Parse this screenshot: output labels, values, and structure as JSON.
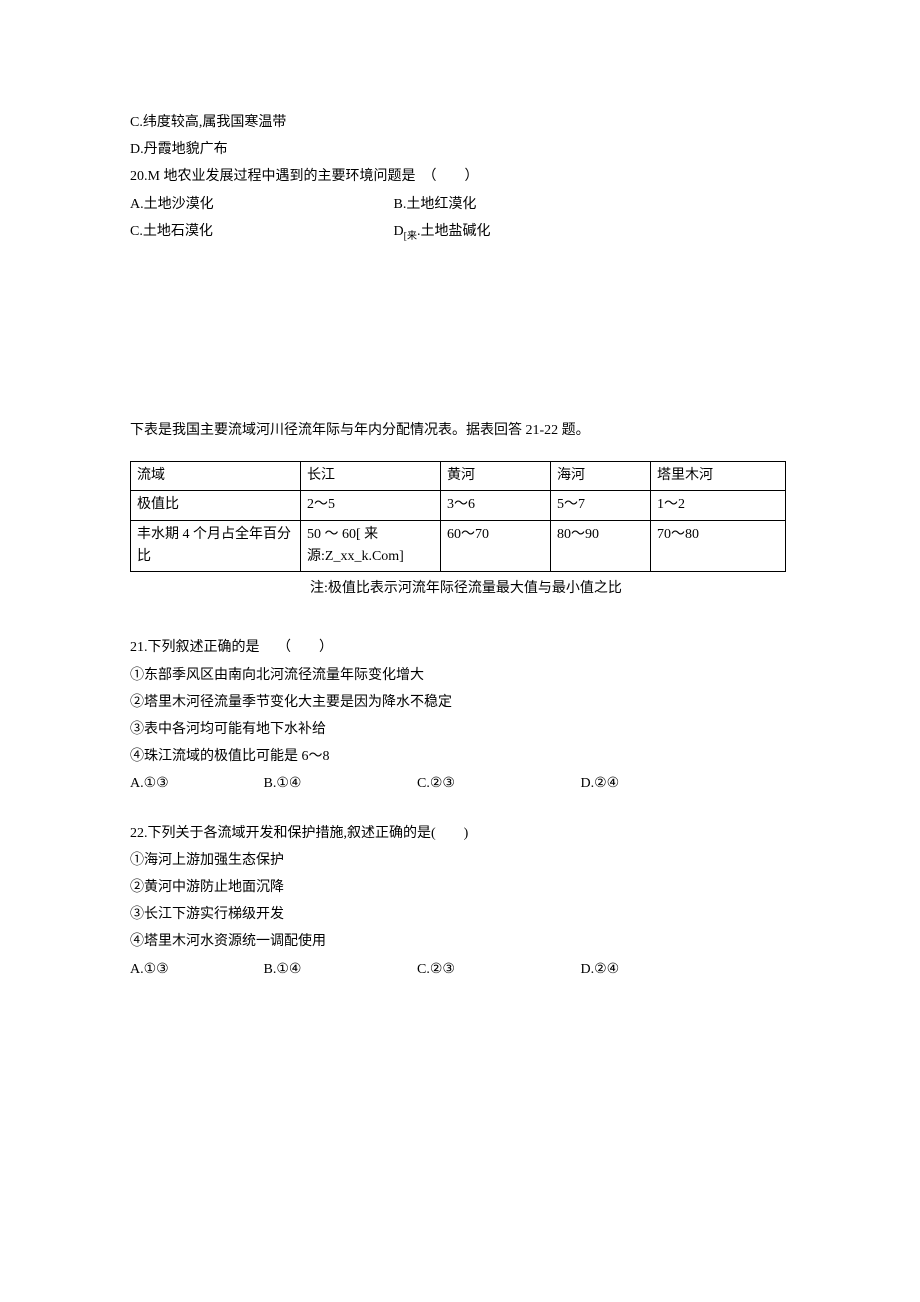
{
  "q19_partial": {
    "optC": "C.纬度较高,属我国寒温带",
    "optD": "D.丹霞地貌广布"
  },
  "q20": {
    "stem": "20.M 地农业发展过程中遇到的主要环境问题是　（　　）",
    "optA": "A.土地沙漠化",
    "optB": "B.土地红漠化",
    "optC": "C.土地石漠化",
    "optD_prefix": "D",
    "optD_sub": "[来",
    "optD_rest": ".土地盐碱化"
  },
  "chart_data": {
    "type": "table",
    "title": "我国主要流域河川径流年际与年内分配情况表",
    "columns": [
      "流域",
      "长江",
      "黄河",
      "海河",
      "塔里木河"
    ],
    "rows": [
      {
        "label": "极值比",
        "values": [
          "2～5",
          "3～6",
          "5～7",
          "1～2"
        ]
      },
      {
        "label": "丰水期 4 个月占全年百分比",
        "values": [
          "50 ～ 60[ 来源:Z_xx_k.Com]",
          "60～70",
          "80～90",
          "70～80"
        ]
      }
    ],
    "note": "注:极值比表示河流年际径流量最大值与最小值之比"
  },
  "table_intro": "下表是我国主要流域河川径流年际与年内分配情况表。据表回答 21-22 题。",
  "table": {
    "h_basin": "流域",
    "h_chang": "长江",
    "h_huang": "黄河",
    "h_hai": "海河",
    "h_tarim": "塔里木河",
    "r1_label": "极值比",
    "r1_chang": "2～5",
    "r1_huang": "3～6",
    "r1_hai": "5～7",
    "r1_tarim": "1～2",
    "r2_label": "丰水期 4 个月占全年百分比",
    "r2_chang": "50 ～ 60[ 来源:Z_xx_k.Com]",
    "r2_huang": "60～70",
    "r2_hai": "80～90",
    "r2_tarim": "70～80",
    "note": "注:极值比表示河流年际径流量最大值与最小值之比"
  },
  "q21": {
    "stem": "21.下列叙述正确的是　 （　　）",
    "s1": "①东部季风区由南向北河流径流量年际变化增大",
    "s2": "②塔里木河径流量季节变化大主要是因为降水不稳定",
    "s3": "③表中各河均可能有地下水补给",
    "s4": "④珠江流域的极值比可能是 6～8",
    "optA": "A.①③",
    "optB": "B.①④",
    "optC": "C.②③",
    "optD": "D.②④"
  },
  "q22": {
    "stem": "22.下列关于各流域开发和保护措施,叙述正确的是(　　)",
    "s1": "①海河上游加强生态保护",
    "s2": "②黄河中游防止地面沉降",
    "s3": "③长江下游实行梯级开发",
    "s4": "④塔里木河水资源统一调配使用",
    "optA": "A.①③",
    "optB": "B.①④",
    "optC": "C.②③",
    "optD": "D.②④"
  }
}
